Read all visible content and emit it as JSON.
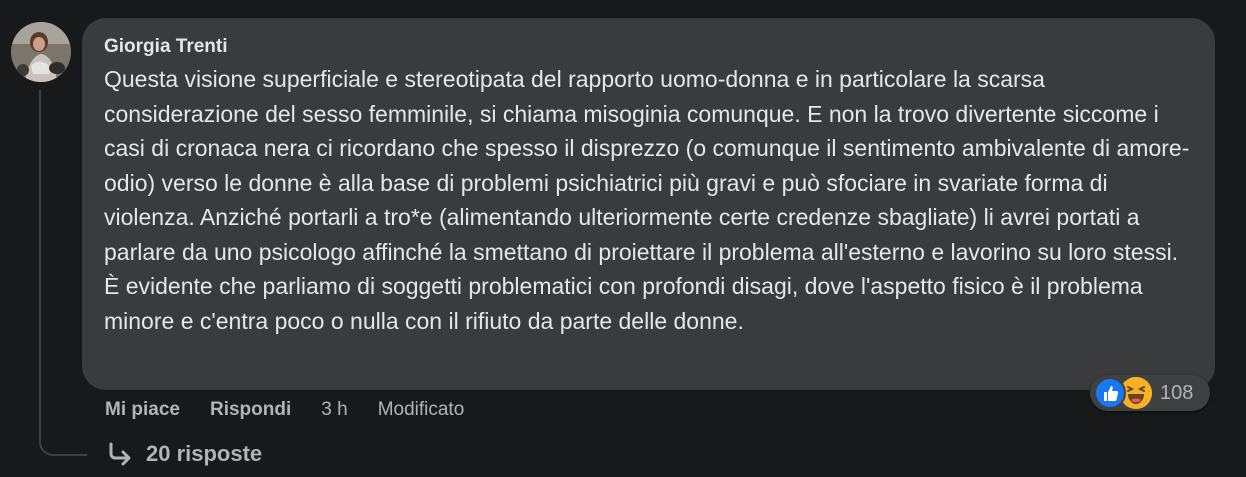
{
  "comment": {
    "author": "Giorgia Trenti",
    "text": "Questa visione superficiale e stereotipata del rapporto uomo-donna e in particolare la scarsa considerazione del sesso femminile, si chiama misoginia comunque. E non la trovo divertente siccome i casi di cronaca nera ci ricordano che spesso il disprezzo (o comunque il sentimento ambivalente di amore-odio) verso le donne è alla base di problemi psichiatrici più gravi e può sfociare in svariate forma di violenza. Anziché portarli a tro*e (alimentando ulteriormente certe credenze sbagliate) li avrei portati a parlare da uno psicologo affinché la smettano di proiettare il problema all'esterno e lavorino su loro stessi. È evidente che parliamo di soggetti problematici con profondi disagi, dove l'aspetto fisico è il problema minore e c'entra poco o nulla con il rifiuto da parte delle donne."
  },
  "actions": {
    "like_label": "Mi piace",
    "reply_label": "Rispondi",
    "time": "3 h",
    "edited": "Modificato"
  },
  "reactions": {
    "icons": [
      "like-icon",
      "haha-icon"
    ],
    "count": "108"
  },
  "replies": {
    "label": "20 risposte"
  },
  "colors": {
    "background": "#18191a",
    "bubble": "#3a3b3c",
    "text": "#e4e6eb",
    "secondary_text": "#b0b3b8",
    "like_blue": "#1877f2",
    "haha_yellow": "#f7b125"
  }
}
